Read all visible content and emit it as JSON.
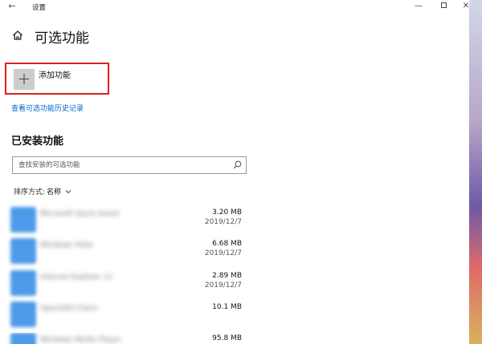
{
  "window": {
    "title": "设置",
    "back_glyph": "←",
    "min_glyph": "—",
    "close_glyph": "✕"
  },
  "page": {
    "title": "可选功能"
  },
  "add_feature": {
    "plus": "+",
    "label": "添加功能"
  },
  "history_link": "查看可选功能历史记录",
  "installed": {
    "title": "已安装功能",
    "search_placeholder": "查找安装的可选功能",
    "sort_label": "排序方式:",
    "sort_value": "名称",
    "items": [
      {
        "name": "Microsoft Quick Assist",
        "size": "3.20 MB",
        "date": "2019/12/7"
      },
      {
        "name": "Windows Hello",
        "size": "6.68 MB",
        "date": "2019/12/7"
      },
      {
        "name": "Internet Explorer 11",
        "size": "2.89 MB",
        "date": "2019/12/7"
      },
      {
        "name": "OpenSSH Client",
        "size": "10.1 MB",
        "date": ""
      },
      {
        "name": "Windows Media Player",
        "size": "95.8 MB",
        "date": ""
      }
    ]
  },
  "colors": {
    "accent_link": "#0066cc",
    "highlight_border": "#e02020",
    "feature_icon": "#4c9be8"
  }
}
